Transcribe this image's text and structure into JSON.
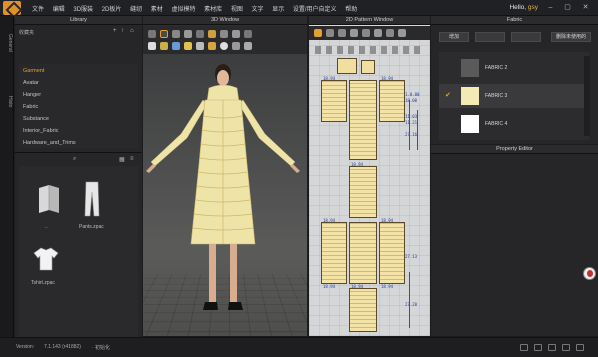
{
  "app": {
    "greeting_prefix": "Hello, ",
    "user": "gsy"
  },
  "menu": [
    "文件",
    "编辑",
    "3D服装",
    "2D板片",
    "缝纫",
    "素材",
    "虚拟模特",
    "素材库",
    "视图",
    "文字",
    "显示",
    "设置/用户自定义",
    "帮助"
  ],
  "sidetabs": {
    "general": "General",
    "history": "Histo"
  },
  "library": {
    "title": "Library",
    "header_label": "收藏夹",
    "items": [
      {
        "label": "Garment",
        "active": true
      },
      {
        "label": "Avatar",
        "active": false
      },
      {
        "label": "Hanger",
        "active": false
      },
      {
        "label": "Fabric",
        "active": false
      },
      {
        "label": "Substance",
        "active": false
      },
      {
        "label": "Interior_Fabric",
        "active": false
      },
      {
        "label": "Hardware_and_Trims",
        "active": false
      }
    ],
    "thumbnails": [
      {
        "label": "..",
        "icon": "folder-icon"
      },
      {
        "label": "Pants.zpac",
        "icon": "pants-icon"
      },
      {
        "label": "Tshirt.zpac",
        "icon": "tshirt-icon"
      }
    ]
  },
  "window3d": {
    "title": "3D Window"
  },
  "window2d": {
    "title": "2D Pattern Window",
    "measurements": [
      "18.94",
      "18.94",
      "1.0.00",
      "18.00",
      "11.03",
      "11.21",
      "27.16",
      "18.94",
      "18.94",
      "18.94",
      "27.13",
      "18.94",
      "18.94",
      "27.28",
      "18.94"
    ]
  },
  "fabric": {
    "title": "Fabric",
    "add_label": "增加",
    "remove_unused_label": "删除未使用的",
    "items": [
      {
        "label": "FABRIC 2",
        "color": "#5a5a5a",
        "selected": false
      },
      {
        "label": "FABRIC 3",
        "color": "#f4eab5",
        "selected": true
      },
      {
        "label": "FABRIC 4",
        "color": "#ffffff",
        "selected": false
      }
    ]
  },
  "property_editor": {
    "title": "Property Editor"
  },
  "statusbar": {
    "version_label": "Version:",
    "version_value": "7.1.143 (r41882)",
    "extra": "· 初始化"
  },
  "colors": {
    "accent": "#e2a030",
    "garment": "#f0e6a8",
    "pattern_bg": "#d5d6d8"
  }
}
